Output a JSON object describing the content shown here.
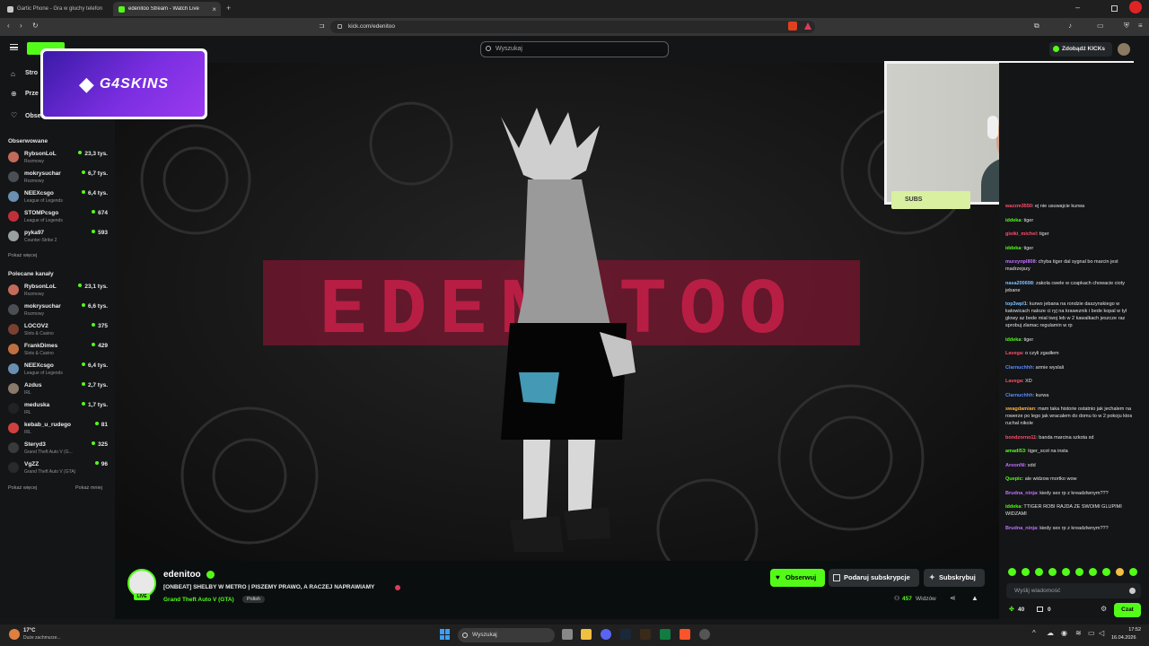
{
  "browser": {
    "tabs": [
      {
        "title": "Gartic Phone - Gra w głuchy telefon",
        "active": false
      },
      {
        "title": "edenitoo Stream - Watch Live",
        "active": true
      }
    ],
    "url": "kick.com/edenitoo"
  },
  "topnav": {
    "search_placeholder": "Wyszukaj",
    "kicks_button": "Zdobądź KICKs"
  },
  "sidebar": {
    "nav": [
      {
        "label": "Stro",
        "icon": "home-icon"
      },
      {
        "label": "Prze",
        "icon": "compass-icon"
      },
      {
        "label": "Obserwowane",
        "icon": "heart-icon"
      }
    ],
    "followed_title": "Obserwowane",
    "followed": [
      {
        "name": "RybsonLoL",
        "category": "Rozmowy",
        "viewers": "23,3 tys.",
        "color": "#c46a5a"
      },
      {
        "name": "mokrysuchar",
        "category": "Rozmowy",
        "viewers": "6,7 tys.",
        "color": "#4a4f55"
      },
      {
        "name": "NEEXcsgo",
        "category": "League of Legends",
        "viewers": "6,4 tys.",
        "color": "#6a8fb0"
      },
      {
        "name": "STOMPcsgo",
        "category": "League of Legends",
        "viewers": "674",
        "color": "#c0303a"
      },
      {
        "name": "pyka97",
        "category": "Counter-Strike 2",
        "viewers": "593",
        "color": "#9aa0a0"
      }
    ],
    "followed_more": "Pokaż więcej",
    "recommended_title": "Polecane kanały",
    "recommended": [
      {
        "name": "RybsonLoL",
        "category": "Rozmowy",
        "viewers": "23,1 tys.",
        "color": "#c46a5a"
      },
      {
        "name": "mokrysuchar",
        "category": "Rozmowy",
        "viewers": "6,6 tys.",
        "color": "#4a4f55"
      },
      {
        "name": "LOCOV2",
        "category": "Slots & Casino",
        "viewers": "375",
        "color": "#7a4030"
      },
      {
        "name": "FrankDimes",
        "category": "Slots & Casino",
        "viewers": "429",
        "color": "#c07040"
      },
      {
        "name": "NEEXcsgo",
        "category": "League of Legends",
        "viewers": "6,4 tys.",
        "color": "#6a8fb0"
      },
      {
        "name": "Azdus",
        "category": "IRL",
        "viewers": "2,7 tys.",
        "color": "#8a7a6a"
      },
      {
        "name": "meduska",
        "category": "IRL",
        "viewers": "1,7 tys.",
        "color": "#222"
      },
      {
        "name": "kebab_u_rudego",
        "category": "IRL",
        "viewers": "81",
        "color": "#d04040"
      },
      {
        "name": "Steryd3",
        "category": "Grand Theft Auto V (G...",
        "viewers": "325",
        "color": "#3a3a3a"
      },
      {
        "name": "VgZZ",
        "category": "Grand Theft Auto V (GTA)",
        "viewers": "96",
        "color": "#2a2a2a"
      }
    ],
    "recommended_more": "Pokaż więcej",
    "recommended_less": "Pokaż mniej"
  },
  "video": {
    "sponsor_logo": "G4SKINS",
    "title_art": "EDENITOO",
    "subs_label": "SUBS"
  },
  "stream": {
    "channel": "edenitoo",
    "live_badge": "LIVE",
    "title": "[ONBEAT] SHELBY W METRO | PISZEMY PRAWO, A RACZEJ NAPRAWIAMY",
    "category": "Grand Theft Auto V (GTA)",
    "language": "Polish",
    "follow_button": "Obserwuj",
    "gift_button": "Podaruj subskrypcje",
    "subscribe_button": "Subskrybuj",
    "viewers": "457",
    "viewers_label": "Widzów"
  },
  "chat": {
    "messages": [
      {
        "user": "wazzm3550",
        "text": ": ej nie usuwajcie kurwa",
        "color": "#ff4d6a"
      },
      {
        "user": "iddeka",
        "text": ": tiger",
        "color": "#53fc18"
      },
      {
        "user": "gistki_michel",
        "text": ": tiger",
        "color": "#ff4d6a"
      },
      {
        "user": "iddeka",
        "text": ": tiger",
        "color": "#53fc18"
      },
      {
        "user": "murzynpl808",
        "text": ": chyba tiger dal sygnal bo marcin jest madrzejszy",
        "color": "#c070ff"
      },
      {
        "user": "nasa200698",
        "text": ": zakola cwele w czapkach chowacie cioty jebane",
        "color": "#7ac0ff"
      },
      {
        "user": "top3wpl1",
        "text": ": kurwo jebana na rondzie daszynskiego w katowicach naloze ci ryj na kraweznik i bede kopal w tyl glowy az bede mial twoj leb w 2 kawalkach jeszcze raz sprobuj zlamac regulamin w rp",
        "color": "#7ac0ff"
      },
      {
        "user": "iddeka",
        "text": ": tiger",
        "color": "#53fc18"
      },
      {
        "user": "Lavega",
        "text": ": o czyli zgadłem",
        "color": "#ff4d6a"
      },
      {
        "user": "Clarnuchhh",
        "text": ": armie wyslali",
        "color": "#5a8cff"
      },
      {
        "user": "Lavega",
        "text": ": XD",
        "color": "#ff4d6a"
      },
      {
        "user": "Clarnuchhh",
        "text": ": kurwa",
        "color": "#5a8cff"
      },
      {
        "user": "swagdamian",
        "text": ": mam taka historie ostatnio jak jechalem na rowerze po lego jak wracalem do domu to w 2 pokoju ktos ruchal nikole",
        "color": "#ffb43c"
      },
      {
        "user": "bondzorno11",
        "text": ": banda marcina szkota xd",
        "color": "#ff4d6a"
      },
      {
        "user": "amadi53",
        "text": ": tiger_scot na insta",
        "color": "#53fc18"
      },
      {
        "user": "AroonNi",
        "text": ": xdd",
        "color": "#c070ff"
      },
      {
        "user": "Quepic",
        "text": ": ale widzow mortko wow",
        "color": "#53fc18"
      },
      {
        "user": "Brudna_ninja",
        "text": ": kiedy sex rp z kreadzlwnym???",
        "color": "#c070ff"
      },
      {
        "user": "iddeka",
        "text": ": TTIGER ROBI RAJDA ZE SWOIMI GLUPIMI WIDZAMI",
        "color": "#53fc18"
      },
      {
        "user": "Brudna_ninja",
        "text": ": kiedy sex rp z kreadzlwnym???",
        "color": "#c070ff"
      }
    ],
    "input_placeholder": "Wyślij wiadomość",
    "points": "40",
    "chests": "0",
    "send_button": "Czat"
  },
  "taskbar": {
    "weather_temp": "17°C",
    "weather_desc": "Duże zachmurze...",
    "search": "Wyszukaj",
    "time": "17:52",
    "date": "16.04.2026"
  }
}
